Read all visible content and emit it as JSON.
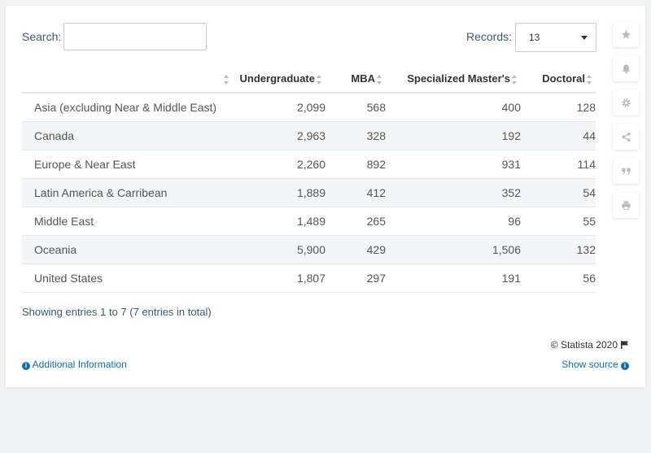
{
  "controls": {
    "search_label": "Search:",
    "search_value": "",
    "records_label": "Records:",
    "records_value": "13"
  },
  "chart_data": {
    "type": "table",
    "columns": [
      "",
      "Undergraduate",
      "MBA",
      "Specialized Master's",
      "Doctoral"
    ],
    "rows": [
      [
        "Asia (excluding Near & Middle East)",
        "2,099",
        "568",
        "400",
        "128"
      ],
      [
        "Canada",
        "2,963",
        "328",
        "192",
        "44"
      ],
      [
        "Europe & Near East",
        "2,260",
        "892",
        "931",
        "114"
      ],
      [
        "Latin America & Carribean",
        "1,889",
        "412",
        "352",
        "54"
      ],
      [
        "Middle East",
        "1,489",
        "265",
        "96",
        "55"
      ],
      [
        "Oceania",
        "5,900",
        "429",
        "1,506",
        "132"
      ],
      [
        "United States",
        "1,807",
        "297",
        "191",
        "56"
      ]
    ]
  },
  "footer": {
    "showing": "Showing entries 1 to 7 (7 entries in total)",
    "copyright": "© Statista 2020",
    "additional_info": "Additional Information",
    "show_source": "Show source"
  },
  "sidebar": {
    "icons": [
      "star-icon",
      "bell-icon",
      "gear-icon",
      "share-icon",
      "quote-icon",
      "print-icon"
    ]
  },
  "colors": {
    "link": "#0a6fb8",
    "label": "#3c5a78",
    "stripe": "#f3f5f7"
  }
}
